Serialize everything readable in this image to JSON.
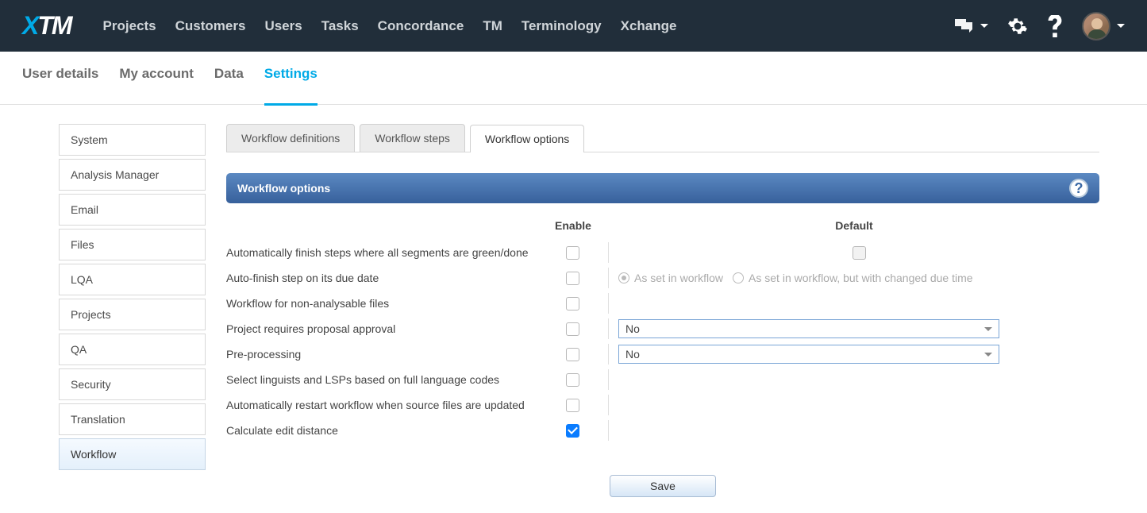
{
  "topnav": {
    "items": [
      "Projects",
      "Customers",
      "Users",
      "Tasks",
      "Concordance",
      "TM",
      "Terminology",
      "Xchange"
    ]
  },
  "subnav": {
    "items": [
      "User details",
      "My account",
      "Data",
      "Settings"
    ],
    "active_index": 3
  },
  "sidebar": {
    "items": [
      "System",
      "Analysis Manager",
      "Email",
      "Files",
      "LQA",
      "Projects",
      "QA",
      "Security",
      "Translation",
      "Workflow"
    ],
    "active_index": 9
  },
  "tabs": {
    "items": [
      "Workflow definitions",
      "Workflow steps",
      "Workflow options"
    ],
    "active_index": 2
  },
  "panel": {
    "title": "Workflow options",
    "col_enable": "Enable",
    "col_default": "Default"
  },
  "options": {
    "row0_label": "Automatically finish steps where all segments are green/done",
    "row1_label": "Auto-finish step on its due date",
    "row1_radio_a": "As set in workflow",
    "row1_radio_b": "As set in workflow, but with changed due time",
    "row2_label": "Workflow for non-analysable files",
    "row3_label": "Project requires proposal approval",
    "row3_value": "No",
    "row4_label": "Pre-processing",
    "row4_value": "No",
    "row5_label": "Select linguists and LSPs based on full language codes",
    "row6_label": "Automatically restart workflow when source files are updated",
    "row7_label": "Calculate edit distance"
  },
  "buttons": {
    "save": "Save"
  }
}
